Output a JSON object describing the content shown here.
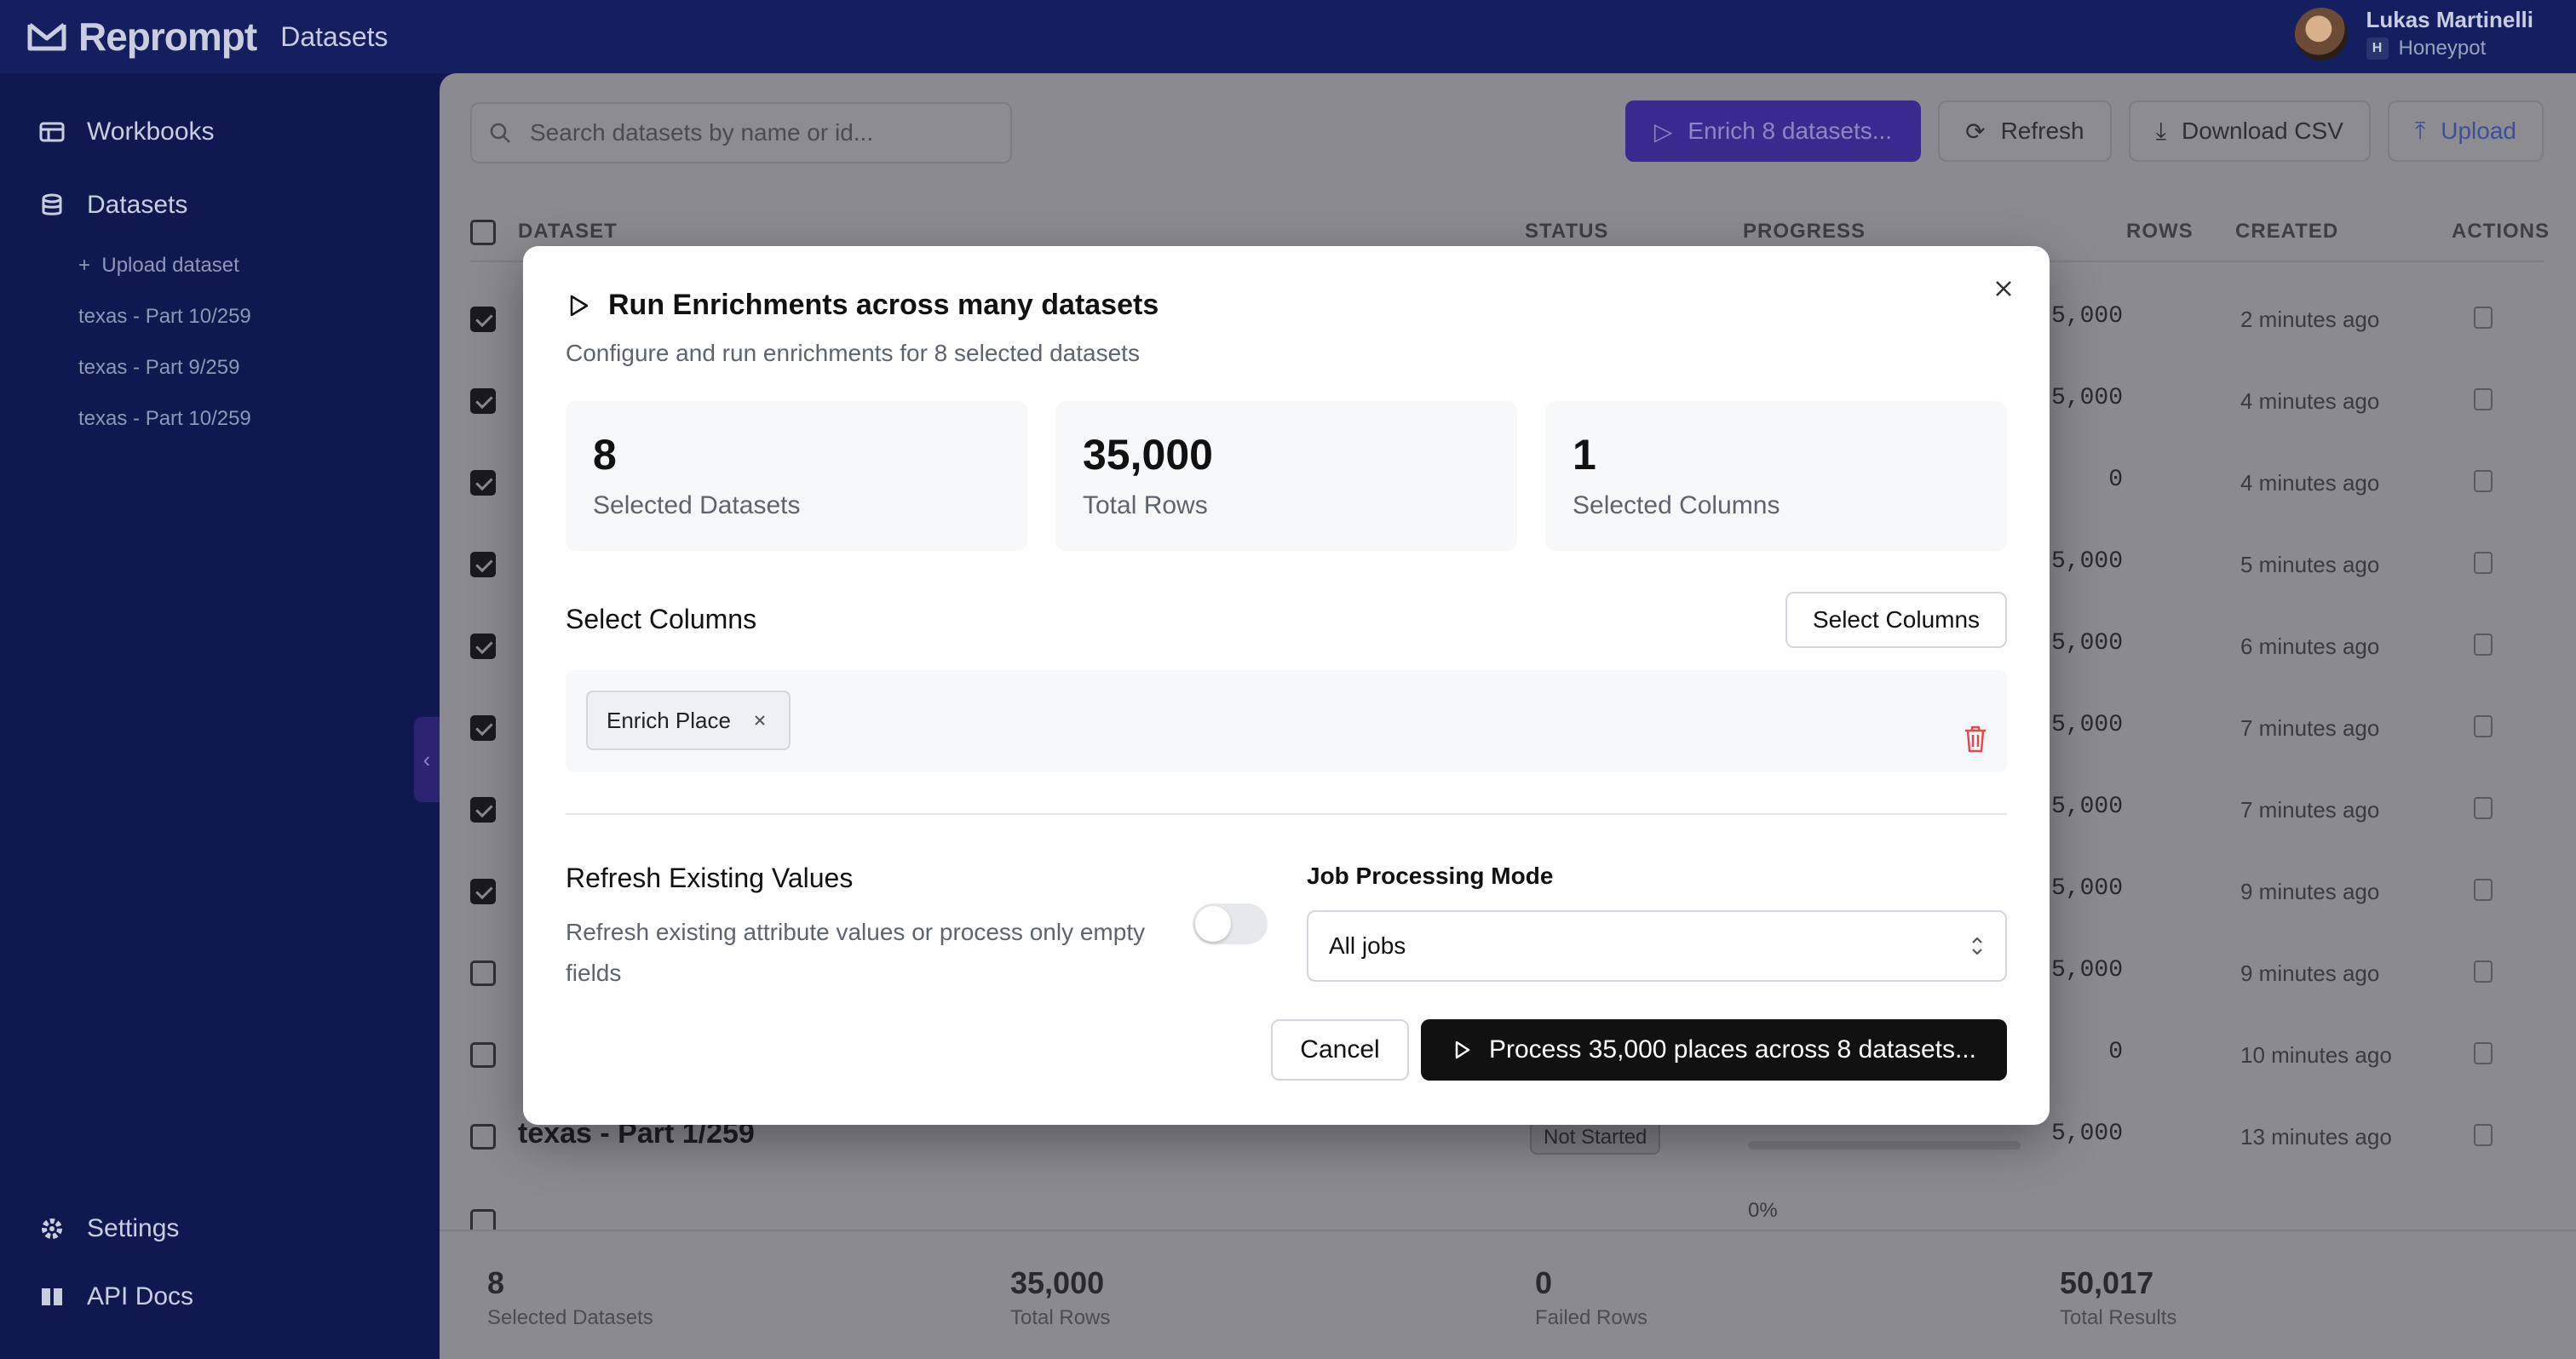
{
  "app": {
    "brand": "Reprompt",
    "section": "Datasets"
  },
  "user": {
    "name": "Lukas Martinelli",
    "org_initial": "H",
    "org": "Honeypot"
  },
  "sidebar": {
    "items": [
      {
        "label": "Workbooks",
        "icon": "table-icon"
      },
      {
        "label": "Datasets",
        "icon": "database-icon"
      }
    ],
    "sub_items": [
      {
        "label": "Upload dataset"
      },
      {
        "label": "texas - Part 10/259"
      },
      {
        "label": "texas - Part 9/259"
      },
      {
        "label": "texas - Part 10/259"
      }
    ],
    "bottom": [
      {
        "label": "Settings",
        "icon": "gear-icon"
      },
      {
        "label": "API Docs",
        "icon": "book-icon"
      }
    ]
  },
  "main": {
    "search_placeholder": "Search datasets by name or id...",
    "toolbar": {
      "enrich_label": "Enrich 8 datasets...",
      "refresh_label": "Refresh",
      "download_label": "Download CSV",
      "upload_label": "Upload"
    },
    "columns": [
      "DATASET",
      "STATUS",
      "PROGRESS",
      "ROWS",
      "CREATED",
      "ACTIONS"
    ],
    "rows": [
      {
        "rows": "5,000",
        "created": "2 minutes ago",
        "checked": true
      },
      {
        "rows": "5,000",
        "created": "4 minutes ago",
        "checked": true
      },
      {
        "rows": "0",
        "created": "4 minutes ago",
        "checked": true
      },
      {
        "rows": "5,000",
        "created": "5 minutes ago",
        "checked": true
      },
      {
        "rows": "5,000",
        "created": "6 minutes ago",
        "checked": true
      },
      {
        "rows": "5,000",
        "created": "7 minutes ago",
        "checked": true
      },
      {
        "rows": "5,000",
        "created": "7 minutes ago",
        "checked": true
      },
      {
        "rows": "5,000",
        "created": "9 minutes ago",
        "checked": true
      },
      {
        "rows": "5,000",
        "created": "9 minutes ago",
        "checked": false
      },
      {
        "rows": "0",
        "created": "10 minutes ago",
        "checked": false
      },
      {
        "name": "texas - Part 1/259",
        "status": "Not Started",
        "rows": "5,000",
        "created": "13 minutes ago",
        "checked": false
      },
      {
        "name": "texas - Part 2/259",
        "progress": "0%",
        "checked": false
      }
    ],
    "footer": [
      {
        "value": "8",
        "label": "Selected Datasets"
      },
      {
        "value": "35,000",
        "label": "Total Rows"
      },
      {
        "value": "0",
        "label": "Failed Rows"
      },
      {
        "value": "50,017",
        "label": "Total Results"
      }
    ]
  },
  "modal": {
    "title": "Run Enrichments across many datasets",
    "subtitle": "Configure and run enrichments for 8 selected datasets",
    "stats": [
      {
        "value": "8",
        "label": "Selected Datasets"
      },
      {
        "value": "35,000",
        "label": "Total Rows"
      },
      {
        "value": "1",
        "label": "Selected Columns"
      }
    ],
    "select_columns_title": "Select Columns",
    "select_columns_button": "Select Columns",
    "chip_label": "Enrich Place",
    "refresh_title": "Refresh Existing Values",
    "refresh_desc": "Refresh existing attribute values or process only empty fields",
    "mode_label": "Job Processing Mode",
    "mode_value": "All jobs",
    "cancel_label": "Cancel",
    "process_label": "Process 35,000 places across 8 datasets..."
  },
  "colors": {
    "sidebar_bg": "#0f1950",
    "primary": "#3a2a8e",
    "process_button": "#111111",
    "trash": "#e5484d"
  }
}
